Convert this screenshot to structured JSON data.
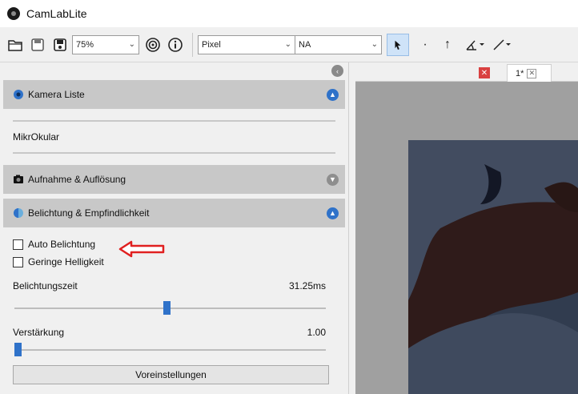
{
  "app": {
    "title": "CamLabLite"
  },
  "toolbar": {
    "zoom": "75%",
    "unit": "Pixel",
    "calibration": "NA",
    "icons": [
      "open-folder-icon",
      "save-icon",
      "save-as-icon",
      "target-icon",
      "info-icon",
      "pointer-icon",
      "point-icon",
      "arrow-up-icon",
      "angle-icon",
      "line-icon"
    ]
  },
  "panel": {
    "camera_list": {
      "title": "Kamera Liste",
      "items": [
        "MikrOkular"
      ]
    },
    "capture": {
      "title": "Aufnahme & Auflösung"
    },
    "exposure": {
      "title": "Belichtung & Empfindlichkeit",
      "auto_exposure": {
        "label": "Auto Belichtung",
        "checked": false
      },
      "low_brightness": {
        "label": "Geringe Helligkeit",
        "checked": false
      },
      "exposure_time": {
        "label": "Belichtungszeit",
        "value": "31.25ms",
        "level": 0.49
      },
      "gain": {
        "label": "Verstärkung",
        "value": "1.00",
        "level": 0.0
      },
      "presets_label": "Voreinstellungen"
    }
  },
  "tabs": {
    "current": "1*"
  },
  "colors": {
    "accent": "#2f72c9",
    "section": "#c8c8c8",
    "close": "#d94040",
    "annotation": "#e02020"
  }
}
